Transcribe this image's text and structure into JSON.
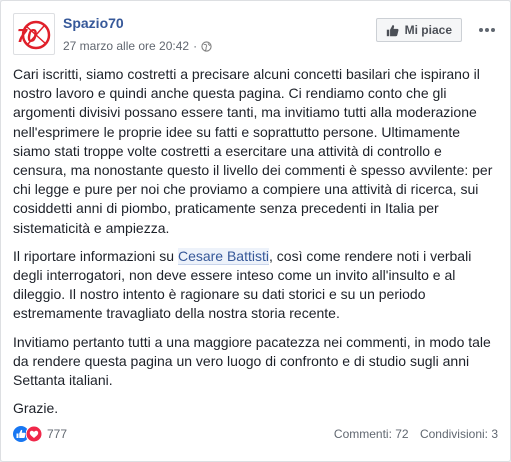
{
  "post": {
    "page_name": "Spazio70",
    "logo_text": "70",
    "timestamp": "27 marzo alle ore 20:42",
    "separator": "·",
    "like_button": "Mi piace",
    "paragraph1": "Cari iscritti, siamo costretti a precisare alcuni concetti basilari che ispirano il nostro lavoro e quindi anche questa pagina. Ci rendiamo conto che gli argomenti divisivi possano essere tanti, ma invitiamo tutti alla moderazione nell'esprimere le proprie idee su fatti e soprattutto persone. Ultimamente siamo stati troppe volte costretti a esercitare una attività di controllo e censura, ma nonostante questo il livello dei commenti è spesso avvilente: per chi legge e pure per noi che proviamo a compiere una attività di ricerca, sui cosiddetti anni di piombo, praticamente senza precedenti in Italia per sistematicità e ampiezza.",
    "paragraph2_before": "Il riportare informazioni su ",
    "paragraph2_mention": "Cesare Battisti",
    "paragraph2_after": ", così come rendere noti i verbali degli interrogatori, non deve essere inteso come un invito all'insulto e al dileggio. Il nostro intento è ragionare su dati storici e su un periodo estremamente travagliato della nostra storia recente.",
    "paragraph3": "Invitiamo pertanto tutti a una maggiore pacatezza nei commenti, in modo tale da rendere questa pagina un vero luogo di confronto e di studio sugli anni Settanta italiani.",
    "paragraph4": "Grazie.",
    "reaction_count": "777",
    "comments": "Commenti: 72",
    "shares": "Condivisioni: 3"
  },
  "colors": {
    "link": "#365899",
    "like": "#1877f2",
    "love": "#f0284a",
    "logo": "#e0202a"
  },
  "icons": [
    "spazio70-logo",
    "globe-icon",
    "thumbs-up-icon",
    "more-options-icon",
    "like-reaction-icon",
    "love-reaction-icon"
  ]
}
